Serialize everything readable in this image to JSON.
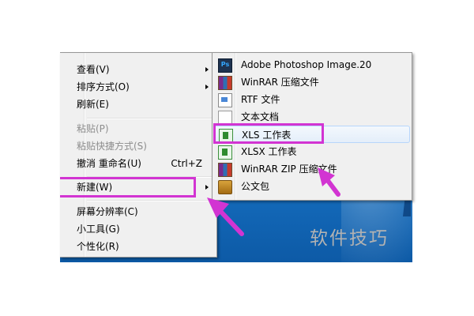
{
  "context_menu": {
    "items": [
      {
        "label": "查看(V)",
        "has_submenu": true
      },
      {
        "label": "排序方式(O)",
        "has_submenu": true
      },
      {
        "label": "刷新(E)"
      },
      {
        "label": "粘贴(P)",
        "disabled": true
      },
      {
        "label": "粘贴快捷方式(S)",
        "disabled": true
      },
      {
        "label": "撤消 重命名(U)",
        "shortcut": "Ctrl+Z"
      },
      {
        "label": "新建(W)",
        "has_submenu": true,
        "highlighted": true
      },
      {
        "label": "屏幕分辨率(C)",
        "icon": "display-icon"
      },
      {
        "label": "小工具(G)",
        "icon": "gadgets-icon"
      },
      {
        "label": "个性化(R)",
        "icon": "personalize-icon"
      }
    ]
  },
  "new_submenu": {
    "items": [
      {
        "label": "Adobe Photoshop Image.20",
        "icon": "photoshop-icon"
      },
      {
        "label": "WinRAR 压缩文件",
        "icon": "winrar-icon"
      },
      {
        "label": "RTF 文件",
        "icon": "rtf-document-icon"
      },
      {
        "label": "文本文档",
        "icon": "text-document-icon"
      },
      {
        "label": "XLS 工作表",
        "icon": "excel-sheet-icon",
        "highlighted": true
      },
      {
        "label": "XLSX 工作表",
        "icon": "excel-sheet-icon"
      },
      {
        "label": "WinRAR ZIP 压缩文件",
        "icon": "winrar-zip-icon"
      },
      {
        "label": "公文包",
        "icon": "briefcase-icon"
      }
    ]
  },
  "watermark": "软件技巧",
  "colors": {
    "highlight": "#d234d2",
    "menu_bg": "#f0f0f0",
    "desktop": "#1670c2"
  }
}
